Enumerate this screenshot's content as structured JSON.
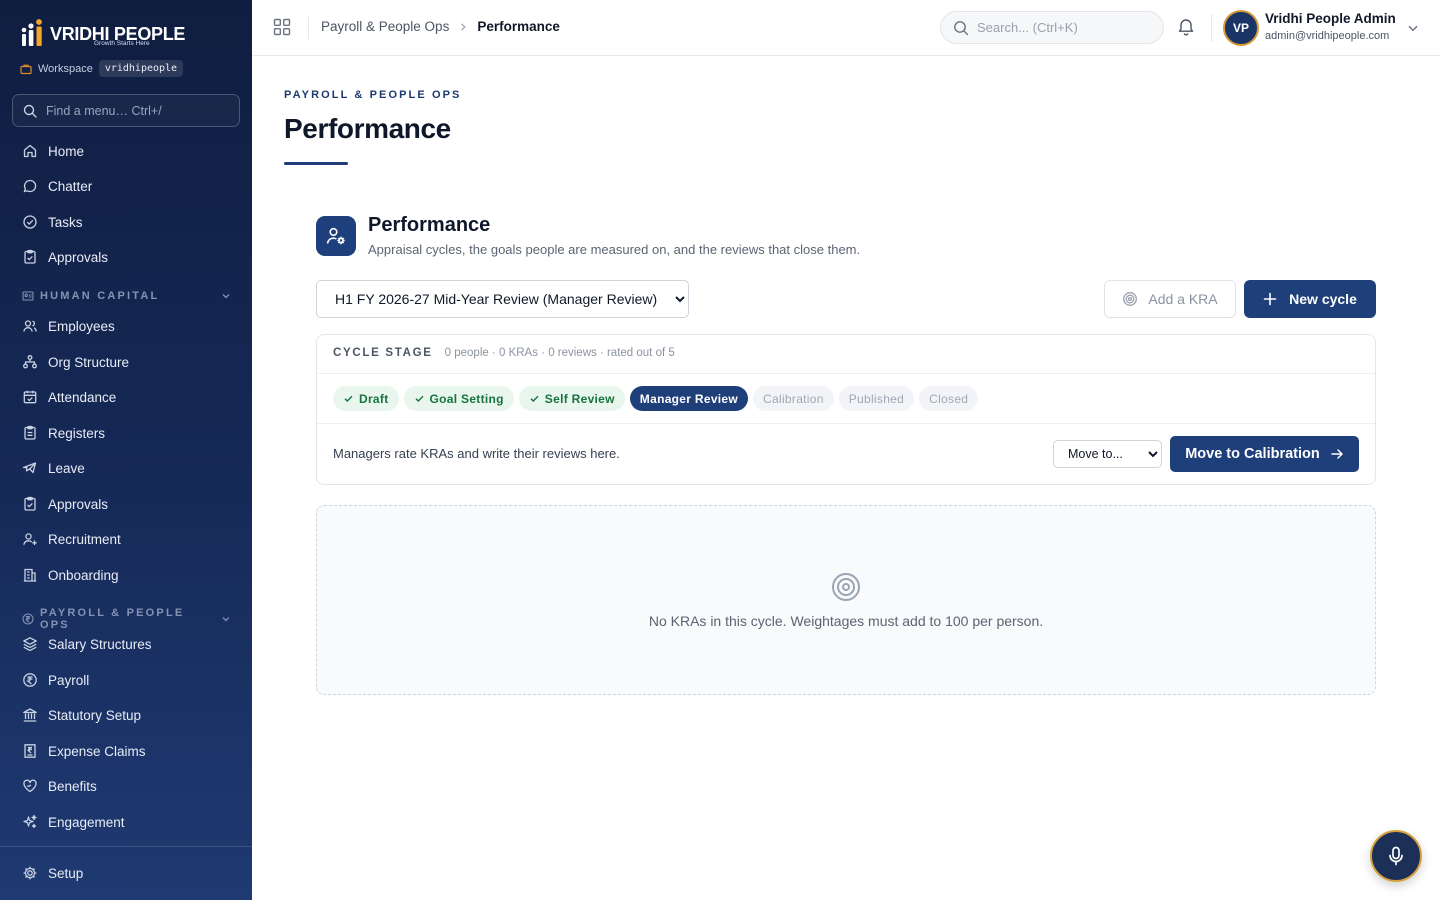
{
  "brand": {
    "name": "VRIDHI PEOPLE",
    "tagline": "Growth Starts Here"
  },
  "workspace": {
    "label": "Workspace",
    "value": "vridhipeople"
  },
  "menu_search": {
    "placeholder": "Find a menu… Ctrl+/"
  },
  "sidebar": {
    "top_items": [
      {
        "label": "Home",
        "icon": "home-icon"
      },
      {
        "label": "Chatter",
        "icon": "chat-icon"
      },
      {
        "label": "Tasks",
        "icon": "check-circle-icon"
      },
      {
        "label": "Approvals",
        "icon": "clipboard-check-icon"
      }
    ],
    "sections": [
      {
        "title": "HUMAN CAPITAL",
        "icon": "id-card-icon",
        "items": [
          {
            "label": "Employees",
            "icon": "users-icon"
          },
          {
            "label": "Org Structure",
            "icon": "org-chart-icon"
          },
          {
            "label": "Attendance",
            "icon": "calendar-check-icon"
          },
          {
            "label": "Registers",
            "icon": "clipboard-icon"
          },
          {
            "label": "Leave",
            "icon": "plane-icon"
          },
          {
            "label": "Approvals",
            "icon": "clipboard-check-icon"
          },
          {
            "label": "Recruitment",
            "icon": "user-plus-icon"
          },
          {
            "label": "Onboarding",
            "icon": "building-icon"
          }
        ]
      },
      {
        "title": "PAYROLL & PEOPLE OPS",
        "icon": "rupee-circle-icon",
        "items": [
          {
            "label": "Salary Structures",
            "icon": "layers-icon"
          },
          {
            "label": "Payroll",
            "icon": "rupee-circle-icon"
          },
          {
            "label": "Statutory Setup",
            "icon": "bank-icon"
          },
          {
            "label": "Expense Claims",
            "icon": "receipt-icon"
          },
          {
            "label": "Benefits",
            "icon": "heart-hand-icon"
          },
          {
            "label": "Engagement",
            "icon": "sparkles-icon"
          }
        ]
      }
    ],
    "footer_item": {
      "label": "Setup",
      "icon": "gear-icon"
    }
  },
  "topbar": {
    "breadcrumb": [
      "Payroll & People Ops",
      "Performance"
    ],
    "search_placeholder": "Search... (Ctrl+K)",
    "user": {
      "initials": "VP",
      "name": "Vridhi People Admin",
      "email": "admin@vridhipeople.com"
    }
  },
  "page": {
    "eyebrow": "PAYROLL & PEOPLE OPS",
    "title": "Performance"
  },
  "module": {
    "title": "Performance",
    "subtitle": "Appraisal cycles, the goals people are measured on, and the reviews that close them.",
    "cycle_selected": "H1 FY 2026-27 Mid-Year Review (Manager Review)",
    "add_kra_label": "Add a KRA",
    "new_cycle_label": "New cycle"
  },
  "stage": {
    "label": "CYCLE STAGE",
    "meta": "0 people · 0 KRAs · 0 reviews · rated out of 5",
    "stages": [
      {
        "label": "Draft",
        "status": "done"
      },
      {
        "label": "Goal Setting",
        "status": "done"
      },
      {
        "label": "Self Review",
        "status": "done"
      },
      {
        "label": "Manager Review",
        "status": "active"
      },
      {
        "label": "Calibration",
        "status": "todo"
      },
      {
        "label": "Published",
        "status": "todo"
      },
      {
        "label": "Closed",
        "status": "todo"
      }
    ],
    "description": "Managers rate KRAs and write their reviews here.",
    "move_to_selected": "Move to...",
    "move_button": "Move to Calibration"
  },
  "empty_state": {
    "icon": "target-icon",
    "text": "No KRAs in this cycle. Weightages must add to 100 per person."
  },
  "colors": {
    "sidebar_top": "#0f1d40",
    "sidebar_bottom": "#1f3a72",
    "accent": "#1e3f7a",
    "gold": "#d59a3a",
    "done_bg": "#e9f6ee",
    "done_fg": "#17733f"
  }
}
